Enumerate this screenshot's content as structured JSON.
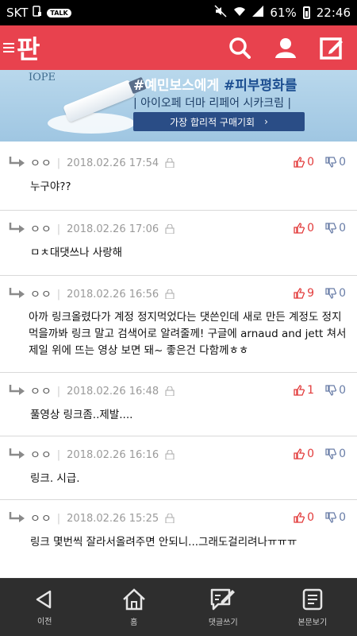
{
  "status": {
    "carrier": "SKT",
    "talk_badge": "TALK",
    "battery": "61%",
    "time": "22:46"
  },
  "appbar": {
    "logo": "판"
  },
  "banner": {
    "brand": "IOPE",
    "headline_1": "#예민보스에게 ",
    "headline_2": "#피부평화를",
    "subtitle": "| 아이오페 더마 리페어 시카크림 |",
    "cta": "가장 합리적 구매기회",
    "cta_arrow": "›"
  },
  "comments": [
    {
      "nick": "ㅇㅇ",
      "date": "2018.02.26 17:54",
      "up": "0",
      "down": "0",
      "text": "누구야??"
    },
    {
      "nick": "ㅇㅇ",
      "date": "2018.02.26 17:06",
      "up": "0",
      "down": "0",
      "text": "ㅁㅊ대댓쓰나 사랑해"
    },
    {
      "nick": "ㅇㅇ",
      "date": "2018.02.26 16:56",
      "up": "9",
      "down": "0",
      "text": "아까 링크올렸다가 계정 정지먹었다는 댓쓴인데 새로 만든 계정도 정지먹을까봐 링크 말고 검색어로 알려줄께! 구글에 arnaud and jett 쳐서 제일 위에 뜨는 영상 보면 돼~ 좋은건 다함께ㅎㅎ"
    },
    {
      "nick": "ㅇㅇ",
      "date": "2018.02.26 16:48",
      "up": "1",
      "down": "0",
      "text": "풀영상 링크좀..제발...."
    },
    {
      "nick": "ㅇㅇ",
      "date": "2018.02.26 16:16",
      "up": "0",
      "down": "0",
      "text": "링크. 시급."
    },
    {
      "nick": "ㅇㅇ",
      "date": "2018.02.26 15:25",
      "up": "0",
      "down": "0",
      "text": "링크 몇번씩 잘라서올려주면 안되니...그래도걸리려나ㅠㅠㅠ"
    }
  ],
  "bottomnav": {
    "prev": "이전",
    "home": "홈",
    "write_comment": "댓글쓰기",
    "view_post": "본문보기"
  },
  "colors": {
    "brand_red": "#e8424e",
    "nav_bg": "#2e2e2e",
    "up_red": "#e23b3b",
    "down_blue": "#6a7ea8"
  },
  "icons": [
    "search-icon",
    "user-icon",
    "write-icon",
    "reply-arrow-icon",
    "lock-icon",
    "thumbs-up-icon",
    "thumbs-down-icon",
    "back-icon",
    "home-icon",
    "comment-write-icon",
    "document-icon"
  ]
}
